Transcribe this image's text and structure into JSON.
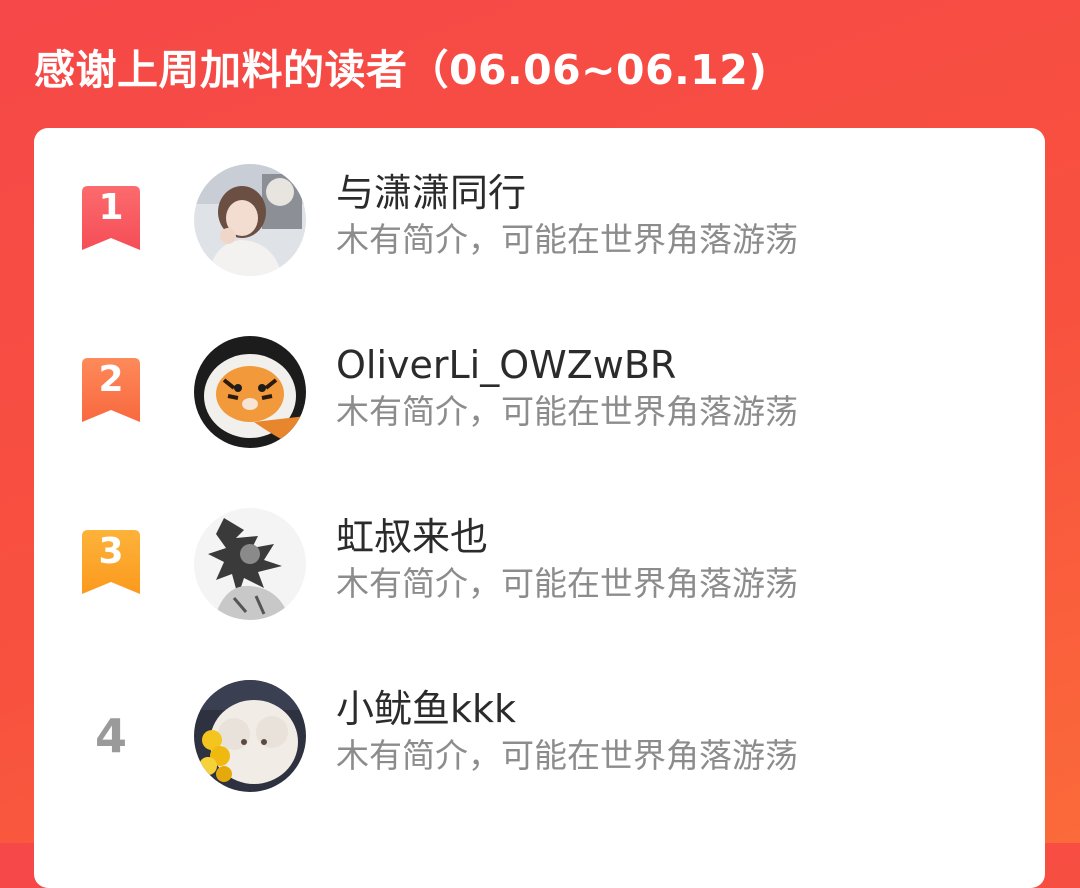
{
  "header": {
    "title": "感谢上周加料的读者（06.06~06.12)"
  },
  "colors": {
    "background": "#f64848",
    "rank_1": "#f95a5f",
    "rank_2": "#fb7a4e",
    "rank_3": "#fca42b",
    "rank_plain": "#9a9a9a"
  },
  "readers": [
    {
      "rank": "1",
      "name": "与潇潇同行",
      "bio": "木有简介，可能在世界角落游荡"
    },
    {
      "rank": "2",
      "name": "OliverLi_OWZwBR",
      "bio": "木有简介，可能在世界角落游荡"
    },
    {
      "rank": "3",
      "name": "虹叔来也",
      "bio": "木有简介，可能在世界角落游荡"
    },
    {
      "rank": "4",
      "name": "小鱿鱼kkk",
      "bio": "木有简介，可能在世界角落游荡"
    }
  ]
}
